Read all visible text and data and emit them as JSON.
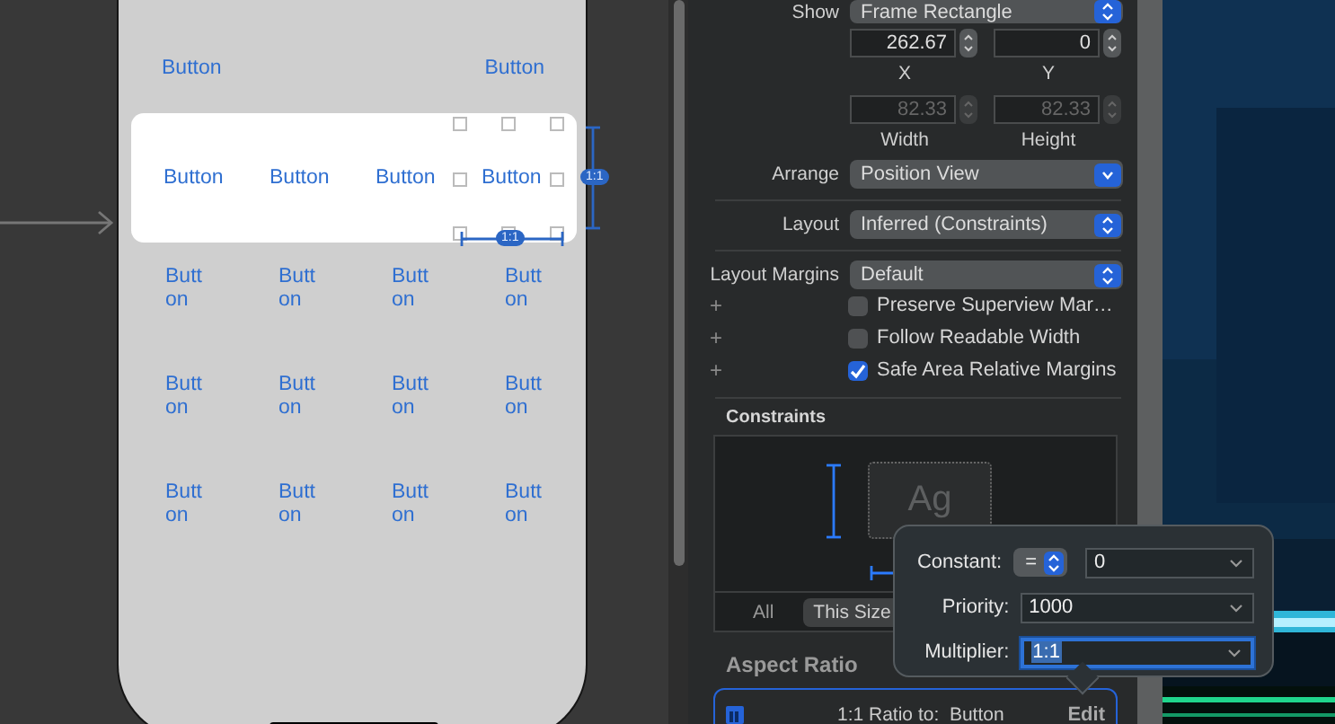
{
  "canvas": {
    "top_buttons": [
      {
        "label": "Button"
      },
      {
        "label": "Button"
      }
    ],
    "stack_buttons": [
      {
        "label": "Button",
        "selected": false
      },
      {
        "label": "Button",
        "selected": false
      },
      {
        "label": "Button",
        "selected": false
      },
      {
        "label": "Button",
        "selected": true
      }
    ],
    "grid_rows": [
      [
        "Butt\non",
        "Butt\non",
        "Butt\non",
        "Butt\non"
      ],
      [
        "Butt\non",
        "Butt\non",
        "Butt\non",
        "Butt\non"
      ],
      [
        "Butt\non",
        "Butt\non",
        "Butt\non",
        "Butt\non"
      ]
    ],
    "constraint_badges": [
      "1:1",
      "1:1"
    ]
  },
  "inspector": {
    "show": {
      "label": "Show",
      "value": "Frame Rectangle",
      "kind": "popup"
    },
    "frame_fields": [
      {
        "label": "X",
        "value": "262.67",
        "disabled": false
      },
      {
        "label": "Y",
        "value": "0",
        "disabled": false
      },
      {
        "label": "Width",
        "value": "82.33",
        "disabled": true
      },
      {
        "label": "Height",
        "value": "82.33",
        "disabled": true
      }
    ],
    "popups": [
      {
        "label": "Arrange",
        "value": "Position View",
        "kind": "pulldown"
      },
      {
        "label": "Layout",
        "value": "Inferred (Constraints)",
        "kind": "popup"
      },
      {
        "label": "Layout Margins",
        "value": "Default",
        "kind": "popup"
      }
    ],
    "checkboxes": [
      {
        "add": "+",
        "label": "Preserve Superview Mar…",
        "checked": false
      },
      {
        "add": "+",
        "label": "Follow Readable Width",
        "checked": false
      },
      {
        "add": "+",
        "label": "Safe Area Relative Margins",
        "checked": true
      }
    ],
    "constraints": {
      "title": "Constraints",
      "preview": "Ag",
      "tabs": [
        {
          "label": "All",
          "selected": false
        },
        {
          "label": "This Size",
          "selected": true
        }
      ]
    },
    "aspect_ratio": {
      "title": "Aspect Ratio",
      "constraint": "1:1 Ratio to:  Button",
      "action": "Edit"
    }
  },
  "popover": {
    "constant": {
      "label": "Constant:",
      "relation": "=",
      "value": "0"
    },
    "priority": {
      "label": "Priority:",
      "value": "1000"
    },
    "multiplier": {
      "label": "Multiplier:",
      "value": "1:1",
      "focused": true
    }
  }
}
